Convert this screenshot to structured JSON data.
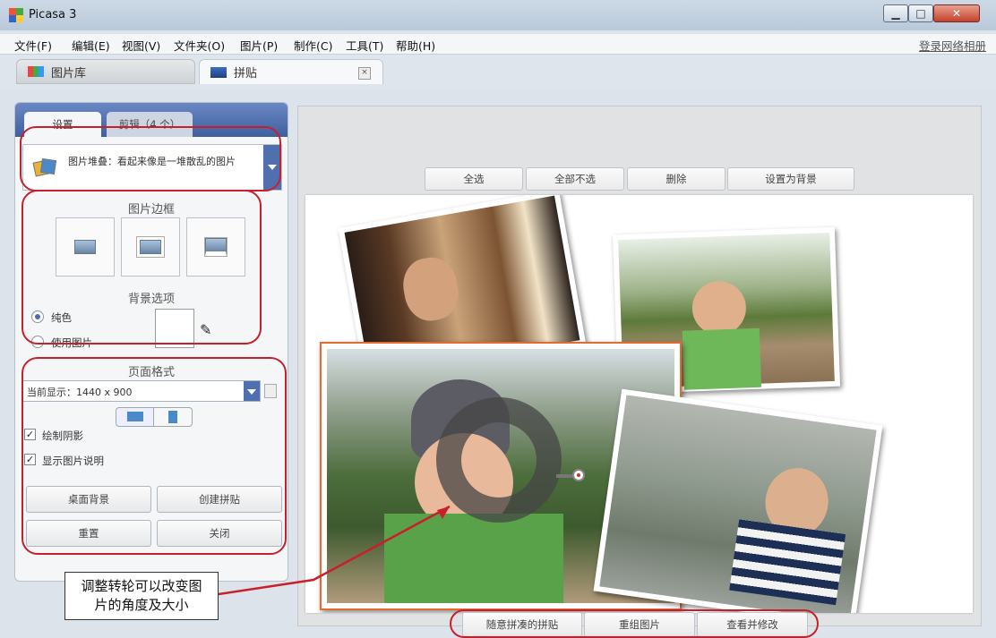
{
  "window": {
    "title": "Picasa 3",
    "min": "▁",
    "max": "□",
    "close": "✕"
  },
  "menu": {
    "items": [
      "文件(F)",
      "编辑(E)",
      "视图(V)",
      "文件夹(O)",
      "图片(P)",
      "制作(C)",
      "工具(T)",
      "帮助(H)"
    ],
    "login": "登录网络相册"
  },
  "tabs": {
    "library": "图片库",
    "collage": "拼贴",
    "close": "×"
  },
  "panel": {
    "tab_settings": "设置",
    "tab_clips": "剪辑（4 个）",
    "collage_type": "图片堆叠：看起来像是一堆散乱的图片",
    "frame_title": "图片边框",
    "bg_title": "背景选项",
    "bg_solid": "纯色",
    "bg_image": "使用图片",
    "page_title": "页面格式",
    "page_format": "当前显示：1440 x 900",
    "draw_shadow": "绘制阴影",
    "show_caption": "显示图片说明",
    "btn_desktop": "桌面背景",
    "btn_create": "创建拼贴",
    "btn_reset": "重置",
    "btn_close": "关闭"
  },
  "toolbar": {
    "select_all": "全选",
    "select_none": "全部不选",
    "delete": "删除",
    "set_bg": "设置为背景"
  },
  "bottom": {
    "random": "随意拼凑的拼贴",
    "regroup": "重组图片",
    "view_edit": "查看并修改"
  },
  "callout": {
    "line1": "调整转轮可以改变图",
    "line2": "片的角度及大小"
  },
  "colors": {
    "annotation_red": "#c8202a",
    "panel_blue": "#4f6fae"
  }
}
